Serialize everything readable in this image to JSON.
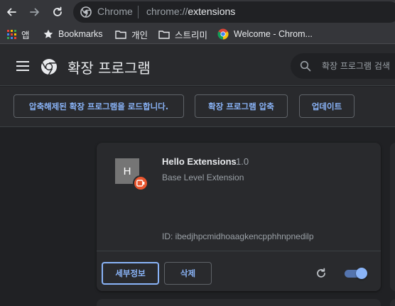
{
  "browser": {
    "omnibox": {
      "site_label": "Chrome",
      "url_scheme": "chrome://",
      "url_host": "extensions"
    },
    "bookmarks": [
      {
        "label": "앱",
        "icon": "apps-grid-icon"
      },
      {
        "label": "Bookmarks",
        "icon": "star-icon"
      },
      {
        "label": "개인",
        "icon": "folder-icon"
      },
      {
        "label": "스트리미",
        "icon": "folder-icon"
      },
      {
        "label": "Welcome - Chrom...",
        "icon": "chrome-icon"
      }
    ]
  },
  "header": {
    "title": "확장 프로그램",
    "search_placeholder": "확장 프로그램 검색"
  },
  "dev_toolbar": {
    "load_unpacked": "압축해제된 확장 프로그램을 로드합니다.",
    "pack": "확장 프로그램 압축",
    "update": "업데이트"
  },
  "extension": {
    "icon_letter": "H",
    "name": "Hello Extensions",
    "version": "1.0",
    "description": "Base Level Extension",
    "id_text": "ID: ibedjhpcmidhoaagkencpphhnpnedilp",
    "details_label": "세부정보",
    "remove_label": "삭제",
    "enabled": true
  },
  "colors": {
    "background": "#202124",
    "surface": "#292a2d",
    "accent": "#8ab4f8",
    "badge": "#e8562f"
  }
}
